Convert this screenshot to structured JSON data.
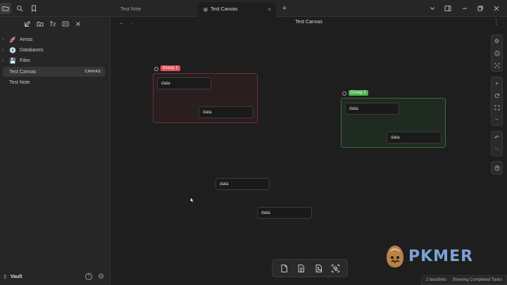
{
  "titlebar": {
    "tabs": [
      {
        "label": "Test Note",
        "active": false
      },
      {
        "label": "Test Canvas",
        "active": true
      }
    ],
    "new_tab": "+",
    "close_tab": "×"
  },
  "sidebar": {
    "items": [
      {
        "label": "Areas",
        "icon": "rocket-icon",
        "glyph": "🚀",
        "has_chevron": true
      },
      {
        "label": "Databases",
        "icon": "disc-icon",
        "glyph": "💿",
        "has_chevron": true
      },
      {
        "label": "Files",
        "icon": "floppy-icon",
        "glyph": "💾",
        "has_chevron": true
      },
      {
        "label": "Test Canvas",
        "badge": "CANVAS",
        "active": true
      },
      {
        "label": "Test Note"
      }
    ],
    "vault_name": "Vault"
  },
  "canvas": {
    "title": "Test Canvas",
    "groups": [
      {
        "label": "Group 1",
        "color": "#e0525c",
        "fill": "#2a1e1f",
        "border": "#6b3338"
      },
      {
        "label": "Group 2",
        "color": "#4cb050",
        "fill": "#1f2a21",
        "border": "#3f6b45"
      }
    ],
    "nodes": [
      {
        "text": "data"
      },
      {
        "text": "data"
      },
      {
        "text": "data"
      },
      {
        "text": "data"
      },
      {
        "text": "data"
      },
      {
        "text": "data"
      }
    ]
  },
  "status": {
    "backlinks": "2 backlinks",
    "tasks": "Showing Completed Tasks"
  },
  "watermark": {
    "text": "PKMER",
    "color": "#7ba3d6"
  }
}
